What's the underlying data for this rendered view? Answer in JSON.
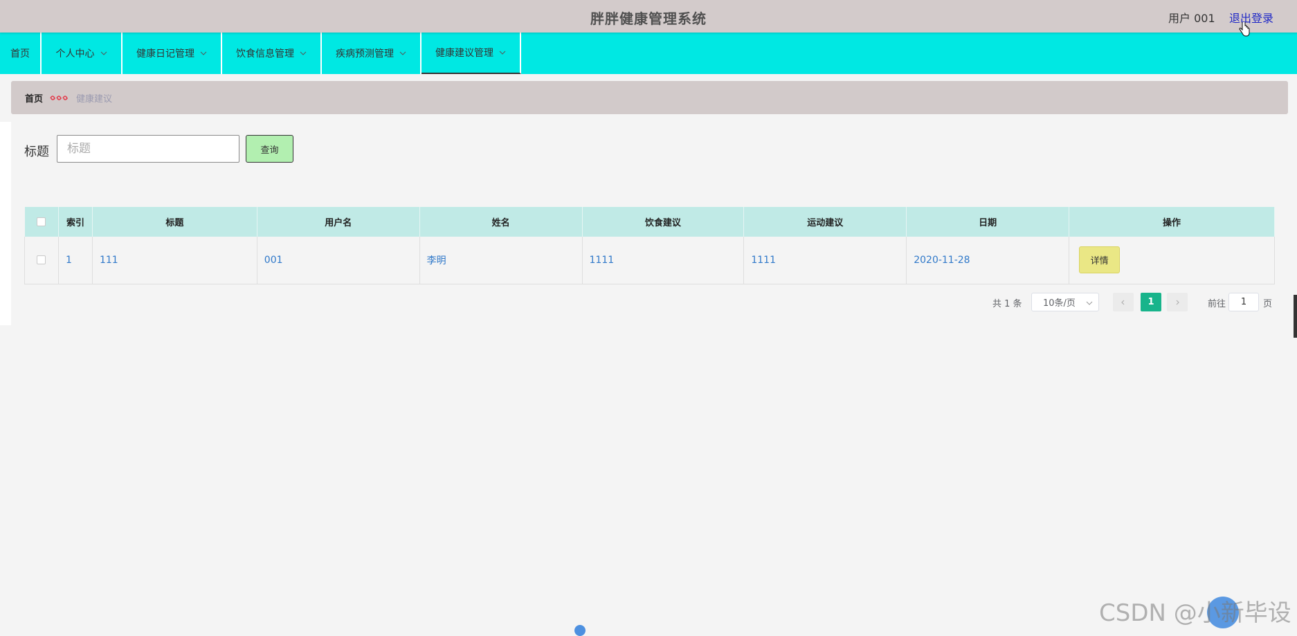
{
  "header": {
    "title": "胖胖健康管理系统",
    "user_label": "用户 001",
    "logout_label": "退出登录"
  },
  "nav": {
    "items": [
      {
        "label": "首页"
      },
      {
        "label": "个人中心"
      },
      {
        "label": "健康日记管理"
      },
      {
        "label": "饮食信息管理"
      },
      {
        "label": "疾病预测管理"
      },
      {
        "label": "健康建议管理"
      }
    ]
  },
  "breadcrumb": {
    "home": "首页",
    "current": "健康建议"
  },
  "search": {
    "label": "标题",
    "placeholder": "标题",
    "button_label": "查询"
  },
  "table": {
    "headers": [
      "",
      "索引",
      "标题",
      "用户名",
      "姓名",
      "饮食建议",
      "运动建议",
      "日期",
      "操作"
    ],
    "rows": [
      {
        "index": "1",
        "title": "111",
        "username": "001",
        "name": "李明",
        "diet": "1111",
        "exercise": "1111",
        "date": "2020-11-28",
        "action": "详情"
      }
    ]
  },
  "pagination": {
    "total": "共 1 条",
    "page_size": "10条/页",
    "current_page": "1",
    "goto_label": "前往",
    "goto_value": "1",
    "page_unit": "页"
  },
  "watermark": "CSDN @小新毕设",
  "colors": {
    "header_bg": "#d3cbcb",
    "nav_bg": "#00e8e3",
    "table_header_bg": "#c0eae6",
    "link": "#2f78c9",
    "search_button_bg": "#b2efb0",
    "detail_button_bg": "#eae785",
    "active_page_bg": "#18b48b"
  }
}
